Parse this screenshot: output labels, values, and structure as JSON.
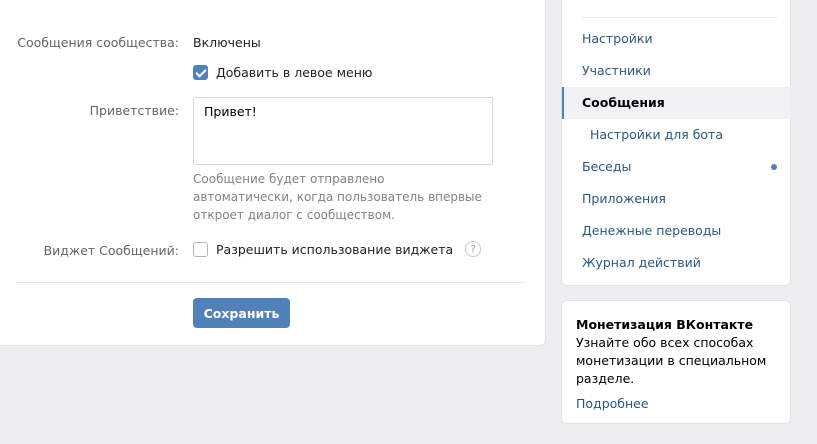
{
  "form": {
    "messages_label": "Сообщения сообщества:",
    "messages_status": "Включены",
    "left_menu_label": "Добавить в левое меню",
    "greeting_label": "Приветствие:",
    "greeting_value": "Привет!",
    "greeting_hint": "Сообщение будет отправлено автоматически, когда пользователь впервые откроет диалог с сообществом.",
    "widget_label": "Виджет Сообщений:",
    "widget_option": "Разрешить использование виджета",
    "help_glyph": "?",
    "save_label": "Сохранить"
  },
  "sidebar": {
    "items": [
      {
        "label": "Настройки"
      },
      {
        "label": "Участники"
      },
      {
        "label": "Сообщения"
      },
      {
        "label": "Настройки для бота"
      },
      {
        "label": "Беседы"
      },
      {
        "label": "Приложения"
      },
      {
        "label": "Денежные переводы"
      },
      {
        "label": "Журнал действий"
      }
    ]
  },
  "promo": {
    "title": "Монетизация ВКонтакте",
    "text": "Узнайте обо всех способах монетизации в специальном разделе.",
    "link": "Подробнее"
  },
  "colors": {
    "accent": "#5181b8",
    "link": "#2a5885",
    "background": "#edeef0"
  }
}
